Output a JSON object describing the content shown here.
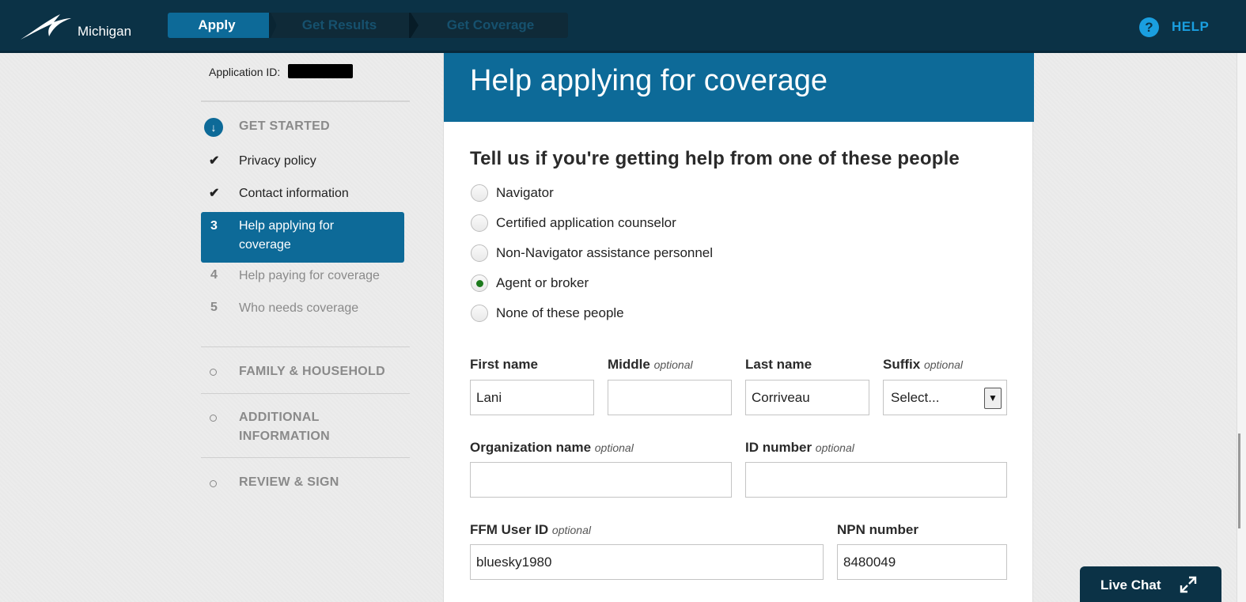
{
  "header": {
    "state_name": "Michigan",
    "steps": [
      "Apply",
      "Get Results",
      "Get Coverage"
    ],
    "help_icon": "?",
    "help_label": "HELP"
  },
  "sidebar": {
    "app_id_label": "Application ID:",
    "get_started": {
      "icon": "↓",
      "label": "GET STARTED"
    },
    "items": [
      {
        "marker": "✔",
        "label": "Privacy policy"
      },
      {
        "marker": "✔",
        "label": "Contact information"
      },
      {
        "marker": "3",
        "label": "Help applying for coverage"
      },
      {
        "marker": "4",
        "label": "Help paying for coverage"
      },
      {
        "marker": "5",
        "label": "Who needs coverage"
      }
    ],
    "sections": [
      {
        "label": "FAMILY & HOUSEHOLD"
      },
      {
        "label": "ADDITIONAL INFORMATION"
      },
      {
        "label": "REVIEW & SIGN"
      }
    ]
  },
  "main": {
    "title": "Help applying for coverage",
    "question": "Tell us if you're getting help from one of these people",
    "options": [
      {
        "label": "Navigator",
        "checked": false
      },
      {
        "label": "Certified application counselor",
        "checked": false
      },
      {
        "label": "Non-Navigator assistance personnel",
        "checked": false
      },
      {
        "label": "Agent or broker",
        "checked": true
      },
      {
        "label": "None of these people",
        "checked": false
      }
    ],
    "optional_word": "optional",
    "fields": {
      "first_name": {
        "label": "First name",
        "value": "Lani"
      },
      "middle": {
        "label": "Middle",
        "value": ""
      },
      "last_name": {
        "label": "Last name",
        "value": "Corriveau"
      },
      "suffix": {
        "label": "Suffix",
        "value": "Select..."
      },
      "organization": {
        "label": "Organization name",
        "value": ""
      },
      "id_number": {
        "label": "ID number",
        "value": ""
      },
      "ffm_user_id": {
        "label": "FFM User ID",
        "value": "bluesky1980"
      },
      "npn_number": {
        "label": "NPN number",
        "value": "8480049"
      }
    }
  },
  "live_chat": {
    "label": "Live Chat"
  },
  "colors": {
    "topbar": "#0b3246",
    "accent": "#0d6a98",
    "help": "#1a9fe0",
    "radio_checked": "#1d7a1d"
  }
}
